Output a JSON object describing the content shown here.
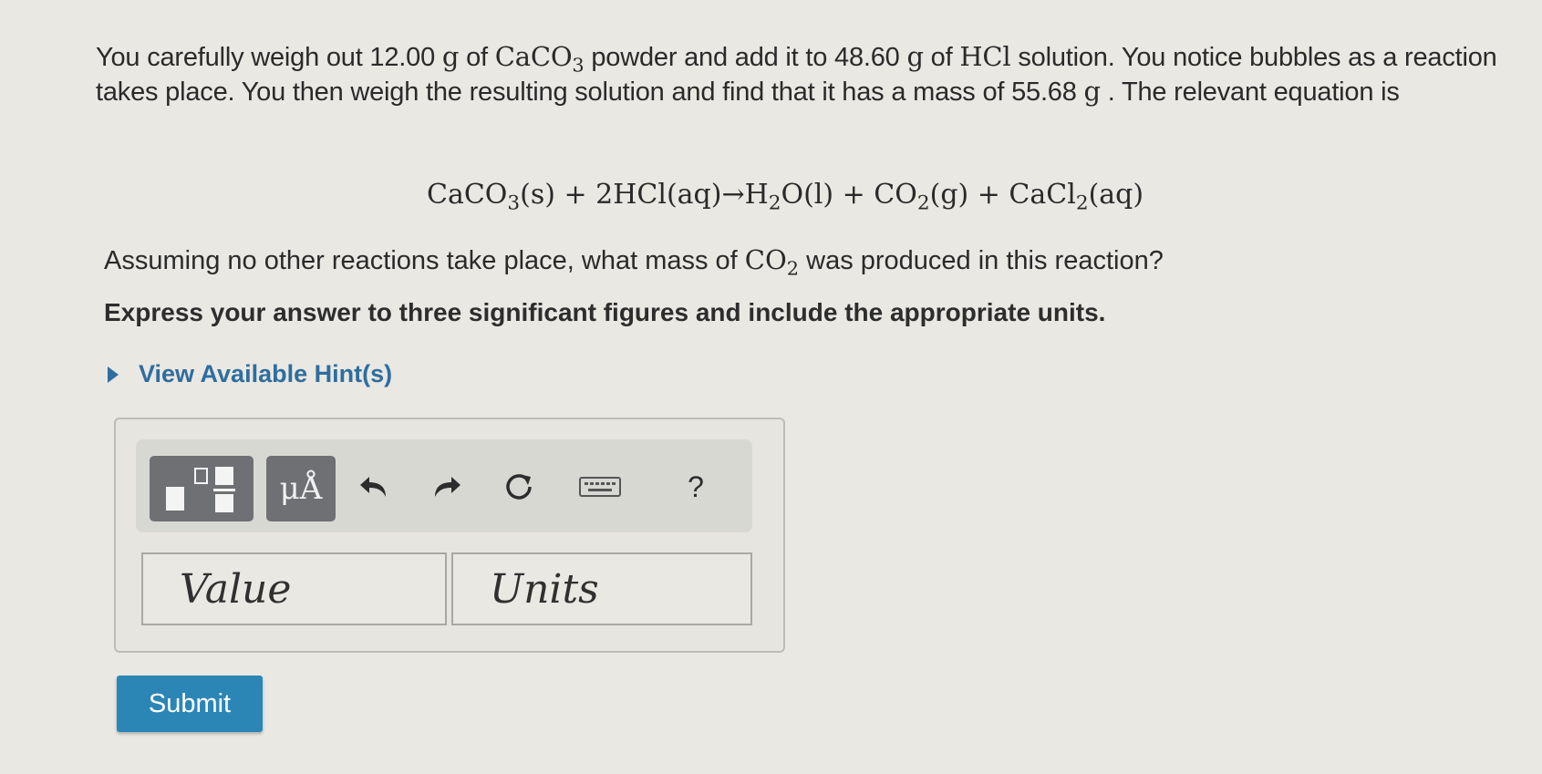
{
  "problem": {
    "line1_a": "You carefully weigh out 12.00 ",
    "g1": "g",
    "line1_b": " of ",
    "caco3_base": "CaCO",
    "caco3_sub": "3",
    "line1_c": " powder and add it to 48.60 ",
    "g2": "g",
    "line1_d": " of ",
    "hcl": "HCl",
    "line1_e": " solution. You notice bubbles as a reaction takes place. You then weigh the resulting solution and find that it has a mass of 55.68 ",
    "g3": "g",
    "line1_f": " . The relevant equation is"
  },
  "equation": {
    "p1": "CaCO",
    "s1": "3",
    "p2": "(s) + 2HCl(aq)→H",
    "s2": "2",
    "p3": "O(l) + CO",
    "s3": "2",
    "p4": "(g) + CaCl",
    "s4": "2",
    "p5": "(aq)"
  },
  "question": {
    "a": "Assuming no other reactions take place, what mass of ",
    "co2_base": "CO",
    "co2_sub": "2",
    "b": " was produced in this reaction?"
  },
  "instruction": "Express your answer to three significant figures and include the appropriate units.",
  "hint_label": "View Available Hint(s)",
  "toolbar": {
    "units_label": "μÅ",
    "help_label": "?"
  },
  "inputs": {
    "value_placeholder": "Value",
    "units_placeholder": "Units"
  },
  "submit_label": "Submit"
}
